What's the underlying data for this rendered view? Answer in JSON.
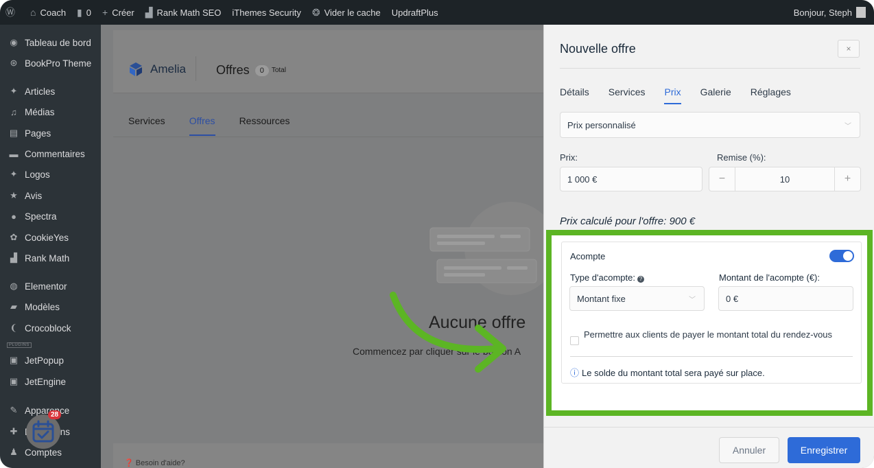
{
  "adminbar": {
    "site_name": "Coach",
    "comments_count": "0",
    "new_label": "Créer",
    "rankmath_label": "Rank Math SEO",
    "ithemes_label": "iThemes Security",
    "cache_label": "Vider le cache",
    "updraft_label": "UpdraftPlus",
    "greeting": "Bonjour, Steph"
  },
  "sidebar": {
    "items": [
      {
        "label": "Tableau de bord",
        "icon": "dashboard-icon"
      },
      {
        "label": "BookPro Theme",
        "icon": "theme-icon"
      },
      {
        "label": "Articles",
        "icon": "pin-icon"
      },
      {
        "label": "Médias",
        "icon": "media-icon"
      },
      {
        "label": "Pages",
        "icon": "page-icon"
      },
      {
        "label": "Commentaires",
        "icon": "comment-icon"
      },
      {
        "label": "Logos",
        "icon": "pin-icon"
      },
      {
        "label": "Avis",
        "icon": "star-icon"
      },
      {
        "label": "Spectra",
        "icon": "spectra-icon"
      },
      {
        "label": "CookieYes",
        "icon": "cookie-icon"
      },
      {
        "label": "Rank Math",
        "icon": "chart-icon"
      },
      {
        "label": "Elementor",
        "icon": "elementor-icon"
      },
      {
        "label": "Modèles",
        "icon": "folder-icon"
      },
      {
        "label": "Crocoblock",
        "icon": "crocoblock-icon"
      },
      {
        "label": "JetPopup",
        "icon": "jet-icon"
      },
      {
        "label": "JetEngine",
        "icon": "jet-icon"
      },
      {
        "label": "Apparence",
        "icon": "brush-icon"
      },
      {
        "label": "Extensions",
        "icon": "plugin-icon"
      },
      {
        "label": "Comptes",
        "icon": "user-icon"
      }
    ],
    "plugins_tag": "PLUGINS"
  },
  "main": {
    "brand": "Amelia",
    "page_title": "Offres",
    "count": "0",
    "count_suffix": "Total",
    "tabs": [
      "Services",
      "Offres",
      "Ressources"
    ],
    "active_tab": "Offres",
    "empty_title": "Aucune offre",
    "empty_sub": "Commencez par cliquer sur le bouton A",
    "help": "Besoin d'aide?"
  },
  "panel": {
    "title": "Nouvelle offre",
    "close": "×",
    "tabs": [
      "Détails",
      "Services",
      "Prix",
      "Galerie",
      "Réglages"
    ],
    "active_tab": "Prix",
    "price_type": "Prix personnalisé",
    "price_label": "Prix:",
    "price_value": "1 000 €",
    "discount_label": "Remise (%):",
    "discount_minus": "−",
    "discount_value": "10",
    "discount_plus": "+",
    "calculated": "Prix calculé pour l'offre: 900 €",
    "deposit": {
      "title": "Acompte",
      "enabled": true,
      "type_label": "Type d'acompte:",
      "amount_label": "Montant de l'acompte (€):",
      "type_value": "Montant fixe",
      "amount_value": "0 €",
      "full_pay_label": "Permettre aux clients de payer le montant total du rendez-vous",
      "note": "Le solde du montant total sera payé sur place."
    },
    "cancel": "Annuler",
    "save": "Enregistrer"
  },
  "float_badge_count": "28",
  "colors": {
    "accent": "#2e6bd8",
    "highlight": "#5cb524",
    "admin_bar": "#1d2327",
    "sidebar": "#2c3338"
  }
}
